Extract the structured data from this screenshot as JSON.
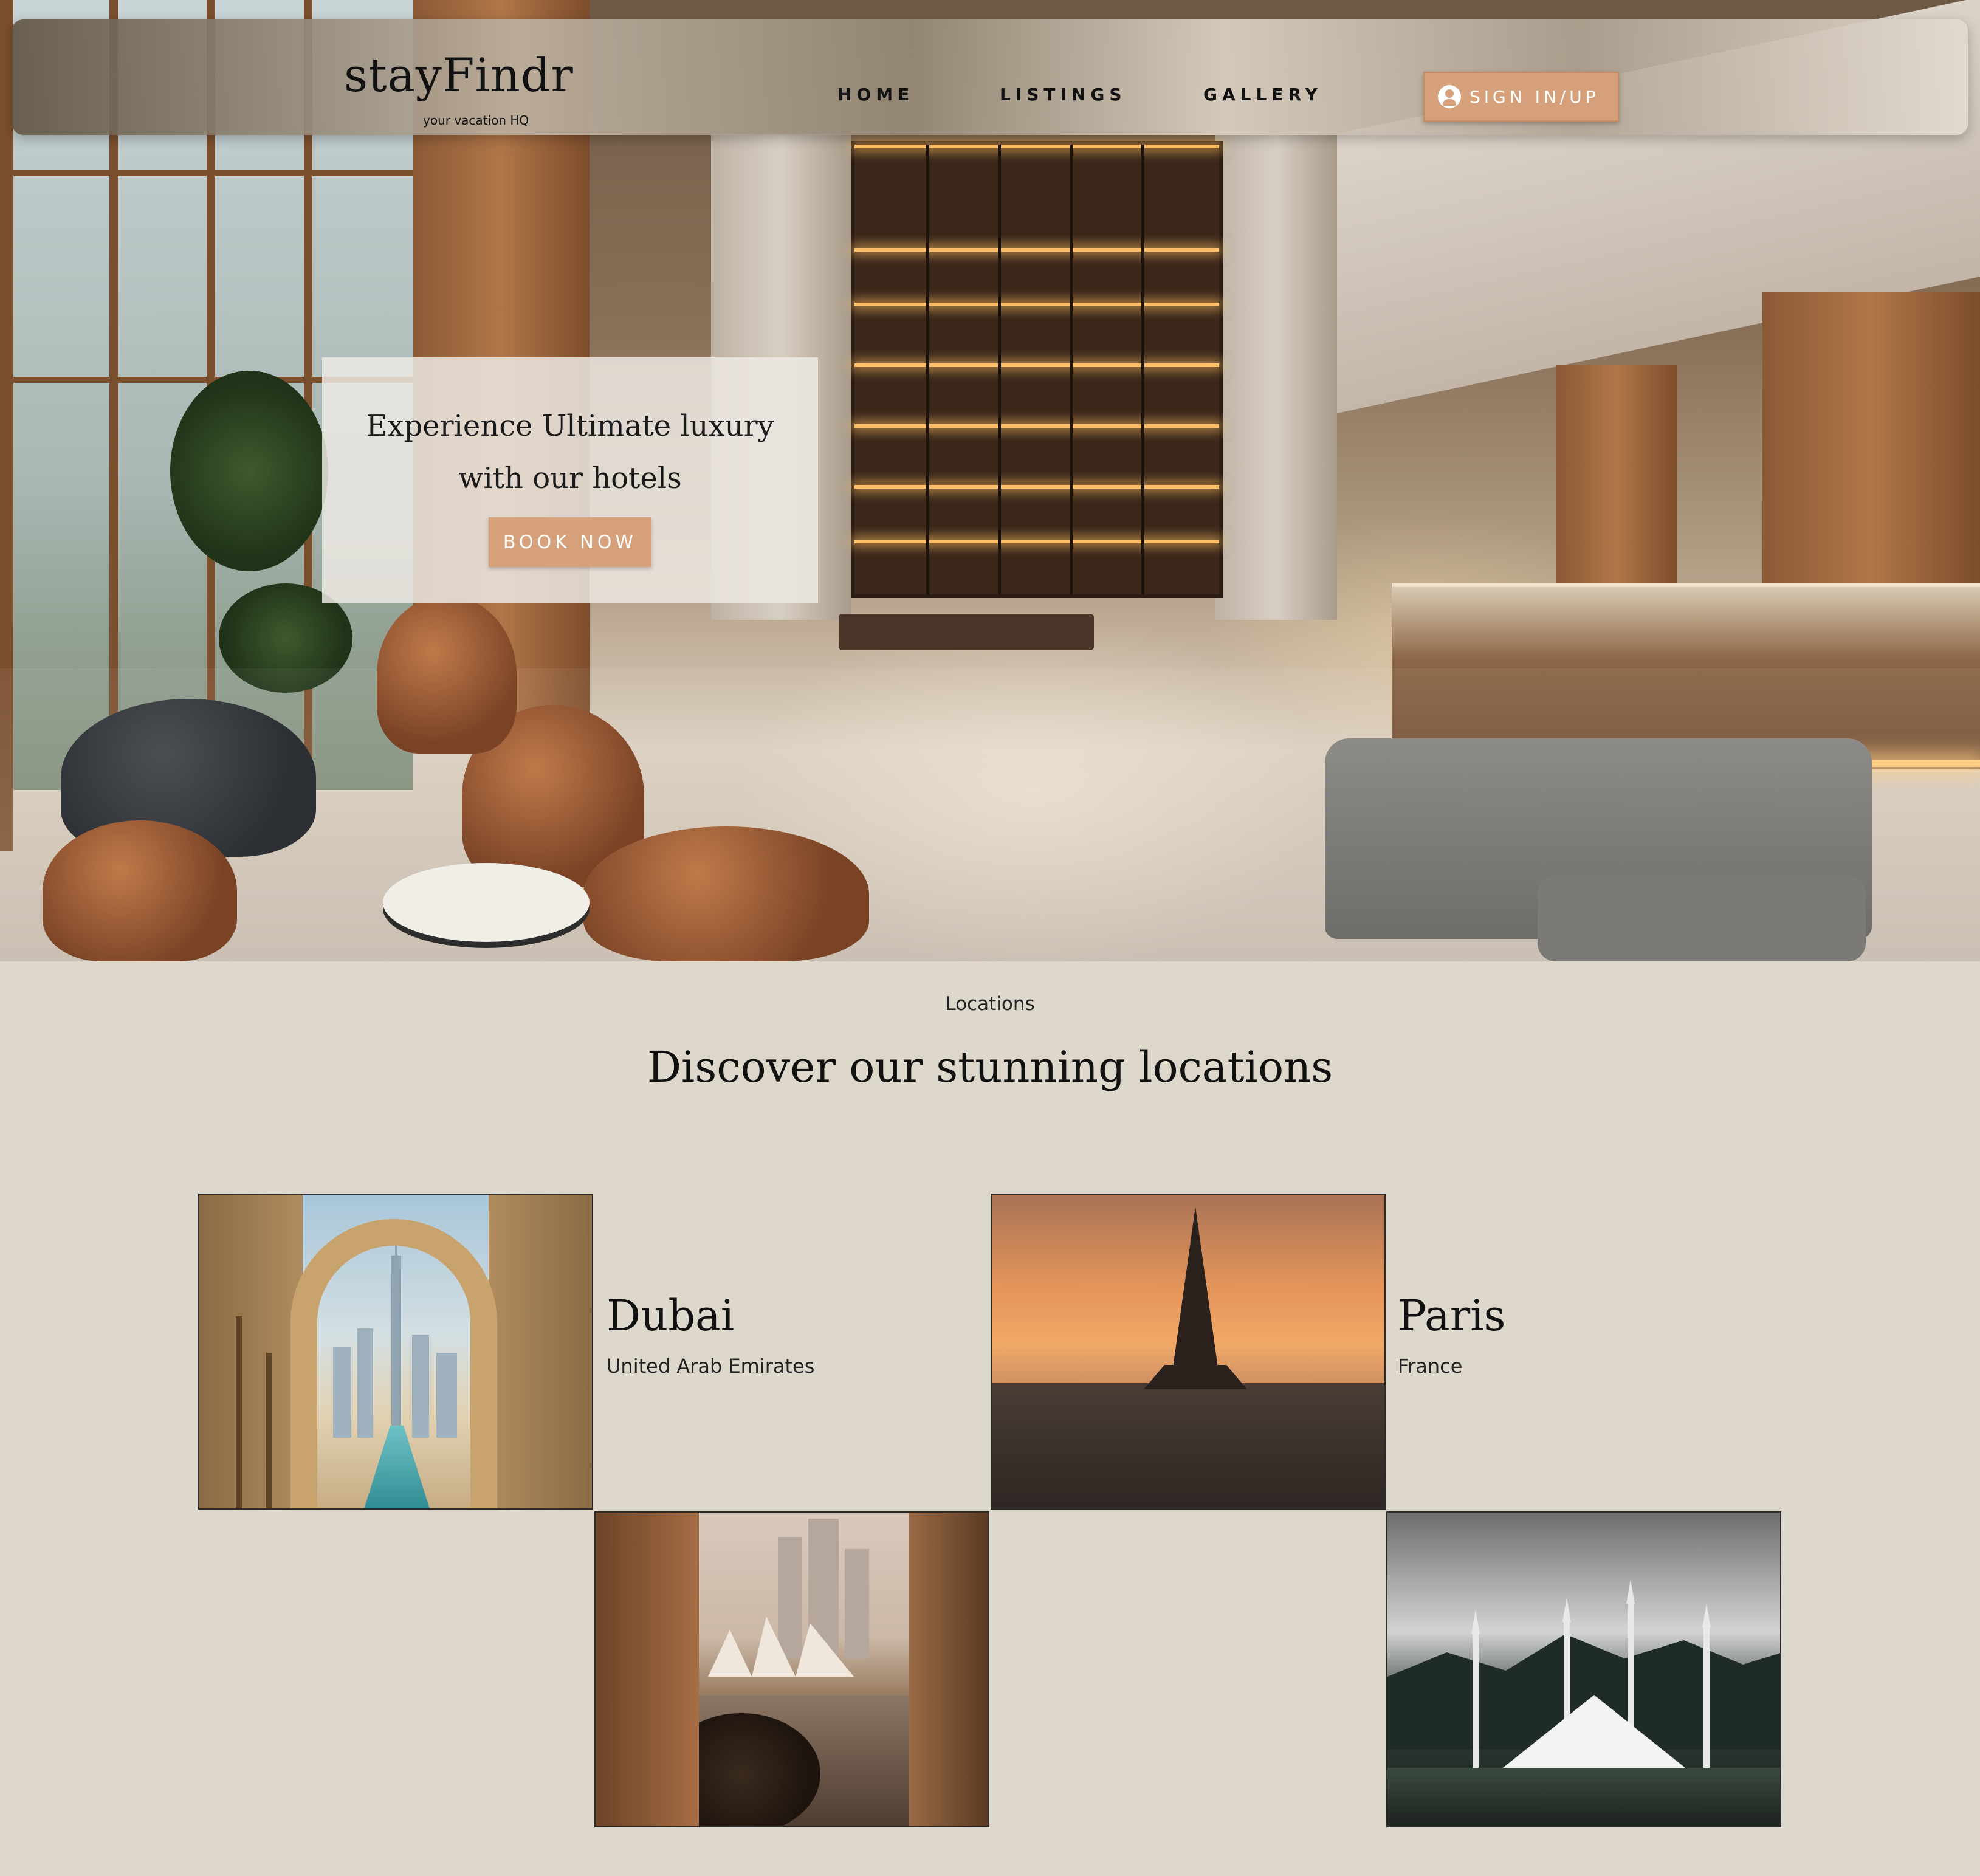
{
  "nav": {
    "logo_title": "stayFindr",
    "logo_subtitle": "your vacation HQ",
    "links": [
      {
        "label": "HOME"
      },
      {
        "label": "LISTINGS"
      },
      {
        "label": "GALLERY"
      }
    ],
    "signin_label": "SIGN IN/UP",
    "signin_icon": "user-circle-icon"
  },
  "hero": {
    "headline_line1": "Experience Ultimate luxury",
    "headline_line2": "with our hotels",
    "cta_label": "BOOK NOW"
  },
  "locations": {
    "eyebrow": "Locations",
    "title": "Discover our stunning locations",
    "items": [
      {
        "city": "Dubai",
        "country": "United Arab Emirates"
      },
      {
        "city": "Paris",
        "country": "France"
      }
    ]
  },
  "colors": {
    "accent": "#d6a07a",
    "page_background": "#ddd8cb",
    "text": "#111111"
  }
}
